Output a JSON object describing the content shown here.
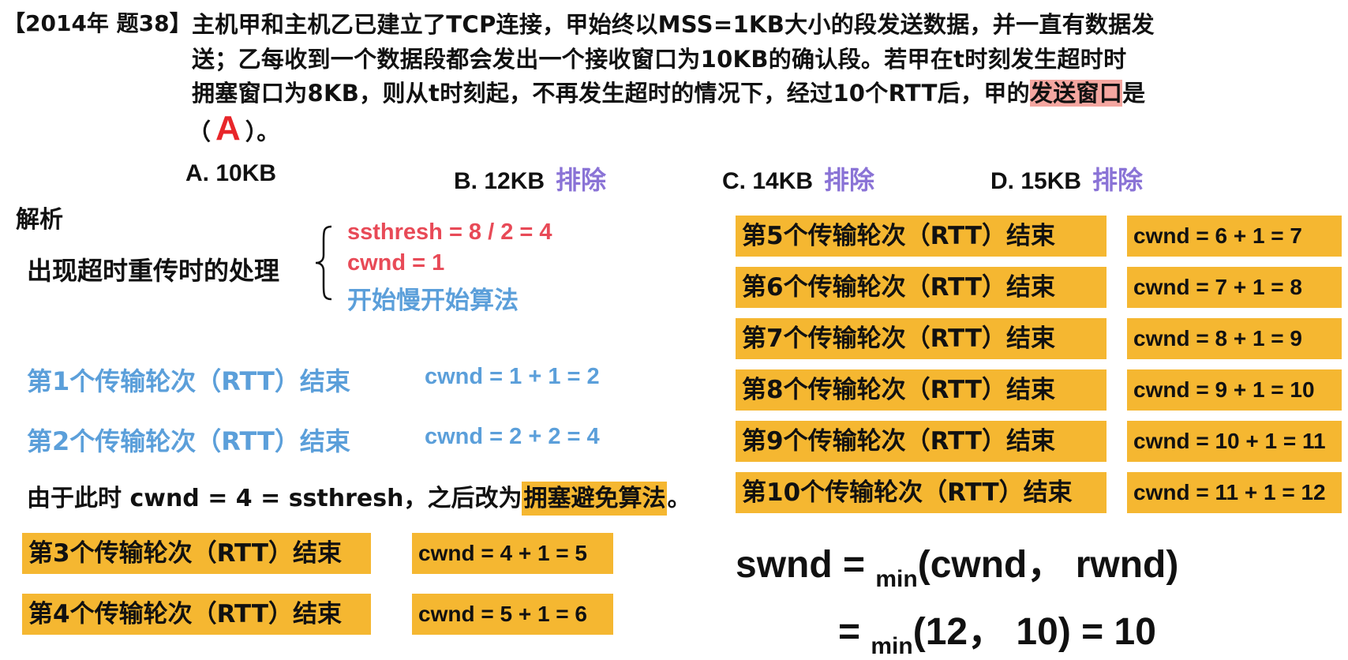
{
  "question": {
    "tag": "【2014年 题38】",
    "line1": "主机甲和主机乙已建立了TCP连接，甲始终以MSS=1KB大小的段发送数据，并一直有数据发",
    "line2": "送；乙每收到一个数据段都会发出一个接收窗口为10KB的确认段。若甲在t时刻发生超时时",
    "line3_prefix": "拥塞窗口为8KB，则从t时刻起，不再发生超时的情况下，经过10个RTT后，甲的",
    "line3_highlight": "发送窗口",
    "line3_suffix": "是",
    "answer_open": "（",
    "answer": "A",
    "answer_close": "）。"
  },
  "options": [
    {
      "label": "A. 10KB",
      "note": ""
    },
    {
      "label": "B. 12KB",
      "note": "排除"
    },
    {
      "label": "C. 14KB",
      "note": "排除"
    },
    {
      "label": "D. 15KB",
      "note": "排除"
    }
  ],
  "analysis": {
    "heading": "解析",
    "timeout_label": "出现超时重传时的处理",
    "steps": [
      "ssthresh = 8 / 2 = 4",
      "cwnd = 1",
      "开始慢开始算法"
    ],
    "slow_start": [
      {
        "round": "第1个传输轮次（RTT）结束",
        "cwnd": "cwnd = 1 + 1 = 2"
      },
      {
        "round": "第2个传输轮次（RTT）结束",
        "cwnd": "cwnd = 2 + 2 = 4"
      }
    ],
    "note_prefix": "由于此时 cwnd = 4 = ssthresh，之后改为",
    "note_highlight": "拥塞避免算法",
    "note_suffix": "。",
    "avoid_left": [
      {
        "round": "第3个传输轮次（RTT）结束",
        "cwnd": "cwnd = 4 + 1 = 5"
      },
      {
        "round": "第4个传输轮次（RTT）结束",
        "cwnd": "cwnd = 5 + 1 = 6"
      }
    ],
    "avoid_right": [
      {
        "round": "第5个传输轮次（RTT）结束",
        "cwnd": "cwnd = 6 + 1 = 7"
      },
      {
        "round": "第6个传输轮次（RTT）结束",
        "cwnd": "cwnd = 7 + 1 = 8"
      },
      {
        "round": "第7个传输轮次（RTT）结束",
        "cwnd": "cwnd = 8 + 1 = 9"
      },
      {
        "round": "第8个传输轮次（RTT）结束",
        "cwnd": "cwnd = 9 + 1 = 10"
      },
      {
        "round": "第9个传输轮次（RTT）结束",
        "cwnd": "cwnd = 10 + 1 = 11"
      },
      {
        "round": "第10个传输轮次（RTT）结束",
        "cwnd": "cwnd = 11 + 1 = 12"
      }
    ],
    "formula": {
      "line1_lhs": "swnd = ",
      "min": "min",
      "line1_rhs": "(cwnd， rwnd)",
      "line2_eq": "= ",
      "line2_rhs": "(12， 10) = 10"
    }
  },
  "colors": {
    "highlight_yellow": "#f5b731",
    "highlight_pink": "#f4a6a0",
    "red": "#e84a57",
    "blue": "#5b9fda",
    "purple": "#8a73d6",
    "answer_red": "#e8262a"
  }
}
